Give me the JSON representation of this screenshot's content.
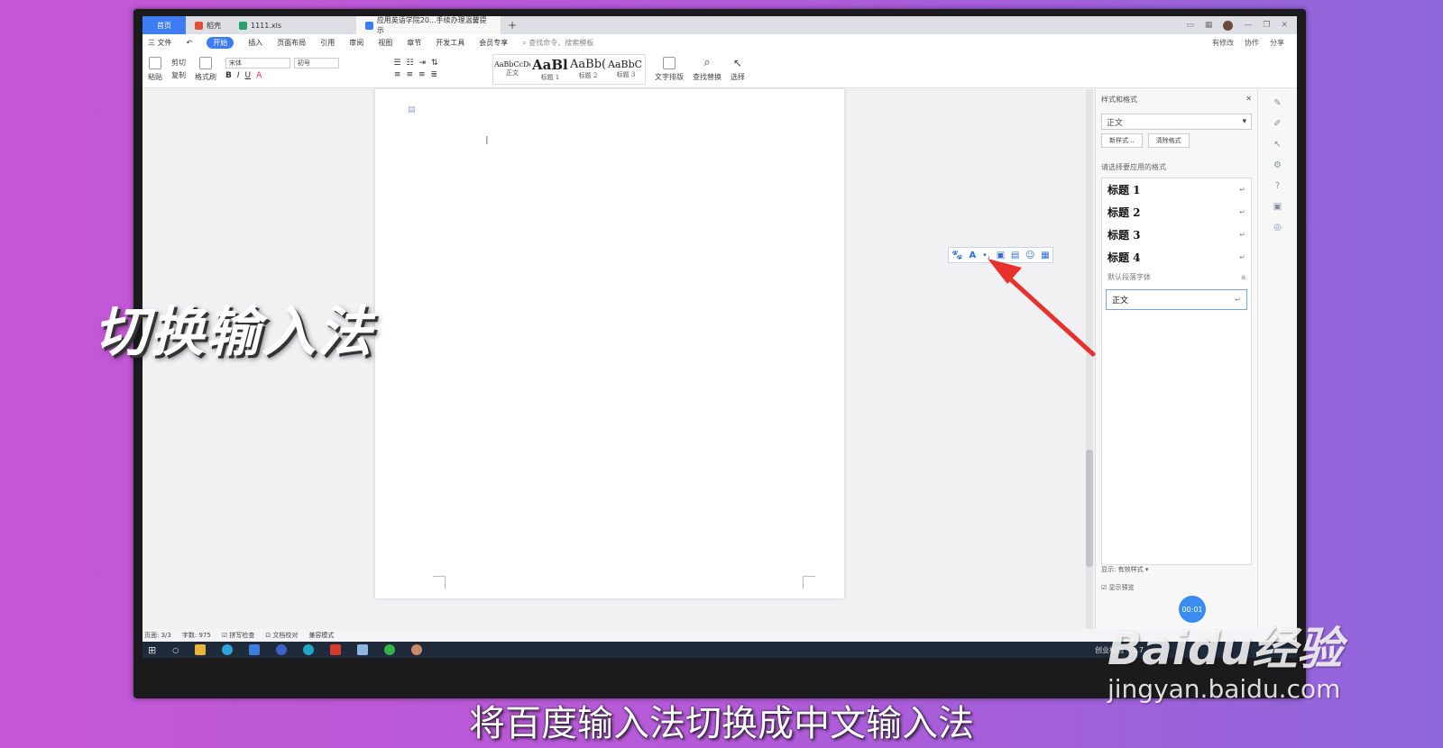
{
  "overlay": {
    "title": "切换输入法",
    "subtitle": "将百度输入法切换成中文输入法",
    "watermark_brand": "Baidu经验",
    "watermark_url": "jingyan.baidu.com"
  },
  "tabs": [
    {
      "label": "首页"
    },
    {
      "label": "稻壳"
    },
    {
      "label": "1111.xls"
    },
    {
      "label": "应用英语学院20...手续办理温馨提示"
    }
  ],
  "tab_plus": "+",
  "menu": {
    "file": "三 文件",
    "items": [
      "开始",
      "插入",
      "页面布局",
      "引用",
      "审阅",
      "视图",
      "章节",
      "开发工具",
      "会员专享"
    ],
    "search": "查找命令、搜索模板",
    "right": [
      "有修改",
      "协作",
      "分享"
    ]
  },
  "ribbon": {
    "paste": "粘贴",
    "cut": "剪切",
    "copy": "复制",
    "format_painter": "格式刷",
    "font_name": "宋体",
    "font_size": "初号",
    "bold": "B",
    "italic": "I",
    "underline": "U",
    "styles": [
      {
        "preview": "AaBbCcDd",
        "caption": "正文"
      },
      {
        "preview": "AaBl",
        "caption": "标题 1"
      },
      {
        "preview": "AaBb(",
        "caption": "标题 2"
      },
      {
        "preview": "AaBbC",
        "caption": "标题 3"
      }
    ],
    "text_layout": "文字排版",
    "find_replace": "查找替换",
    "select": "选择"
  },
  "styles_pane": {
    "title": "样式和格式",
    "current": "正文",
    "new_style": "新样式...",
    "clear_format": "清除格式",
    "hint": "请选择要应用的格式",
    "items": [
      "标题 1",
      "标题 2",
      "标题 3",
      "标题 4"
    ],
    "default_font": "默认段落字体",
    "body": "正文",
    "show_label": "显示:",
    "show_value": "有效样式",
    "preview_label": "显示预览"
  },
  "ime_toolbar": [
    "🐾",
    "A",
    "•,",
    "▣",
    "▤",
    "☺",
    "▦"
  ],
  "status": {
    "page": "页面: 3/3",
    "words": "字数: 975",
    "spell": "拼写检查",
    "proof": "文档校对",
    "compat": "兼容模式"
  },
  "timer": "00:01",
  "taskbar_right": "创业板指 +1.7"
}
